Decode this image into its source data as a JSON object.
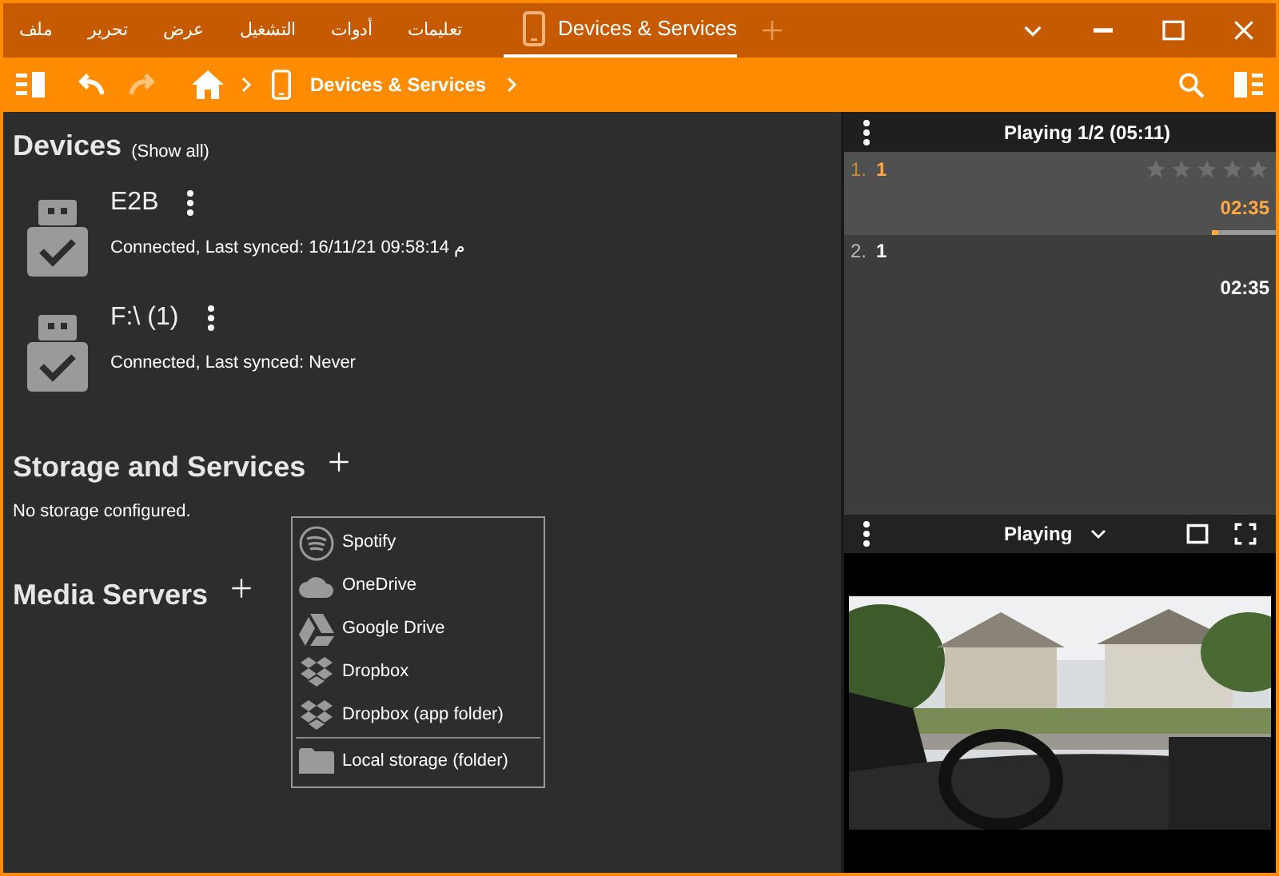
{
  "menu_bar": [
    "تعليمات",
    "أدوات",
    "التشغيل",
    "عرض",
    "تحرير",
    "ملف"
  ],
  "tab": {
    "title": "Devices & Services",
    "selected": true
  },
  "breadcrumb": {
    "current": "Devices & Services"
  },
  "devices_section": {
    "title": "Devices",
    "show_all": "(Show all)",
    "devices": [
      {
        "name": "E2B",
        "status": "Connected, Last synced: 16/11/21 09:58:14 م"
      },
      {
        "name": "F:\\ (1)",
        "status": "Connected, Last synced: Never"
      }
    ]
  },
  "storage_section": {
    "title": "Storage and Services",
    "empty_text": "No storage configured."
  },
  "media_servers_section": {
    "title": "Media Servers"
  },
  "add_menu": {
    "items": [
      "Spotify",
      "OneDrive",
      "Google Drive",
      "Dropbox",
      "Dropbox (app folder)"
    ],
    "footer_item": "Local storage (folder)"
  },
  "playlist": {
    "title": "Playing 1/2 (05:11)",
    "tracks": [
      {
        "number": "1.",
        "title": "1",
        "duration": "02:35",
        "selected": true,
        "stars": 0,
        "level": 0.1
      },
      {
        "number": "2.",
        "title": "1",
        "duration": "02:35",
        "selected": false
      }
    ]
  },
  "player": {
    "title": "Playing"
  }
}
